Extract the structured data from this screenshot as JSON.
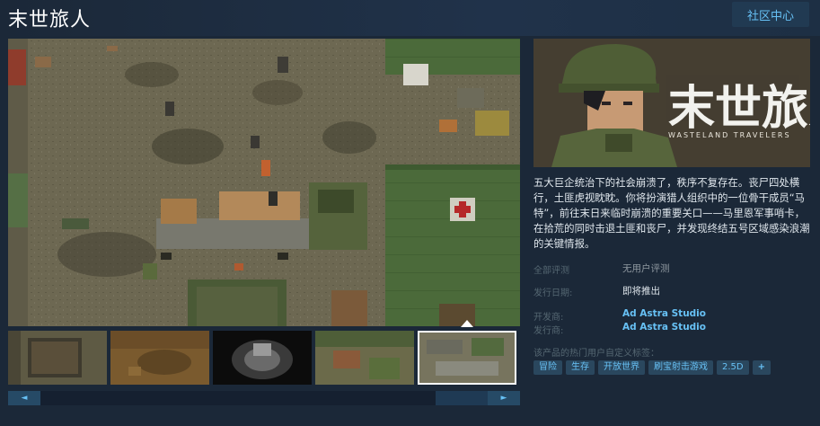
{
  "header": {
    "title": "末世旅人",
    "community_label": "社区中心"
  },
  "capsule": {
    "logo_sub": "WASTELAND TRAVELERS"
  },
  "description": "五大巨企统治下的社会崩溃了，秩序不复存在。丧尸四处横行，土匪虎视眈眈。你将扮演猎人组织中的一位骨干成员“马特”，前往末日来临时崩溃的重要关口——马里恩军事哨卡，在拾荒的同时击退土匪和丧尸，并发现终结五号区域感染浪潮的关键情报。",
  "info": {
    "reviews_label": "全部评测",
    "reviews_value": "无用户评测",
    "release_label": "发行日期:",
    "release_value": "即将推出",
    "developer_label": "开发商:",
    "developer_value": "Ad Astra Studio",
    "publisher_label": "发行商:",
    "publisher_value": "Ad Astra Studio"
  },
  "tags_label": "该产品的热门用户自定义标签：",
  "tags": [
    "冒险",
    "生存",
    "开放世界",
    "刷宝射击游戏",
    "2.5D",
    "+"
  ],
  "media": {
    "thumbnail_count": 5,
    "selected_thumbnail": 5
  },
  "scroll": {
    "left_arrow": "◄",
    "right_arrow": "►"
  },
  "colors": {
    "page_bg": "#1b2838",
    "accent_link": "#67c1f5",
    "tag_bg": "#2a475e",
    "label_gray": "#556772",
    "text_light": "#dfe6ec"
  }
}
